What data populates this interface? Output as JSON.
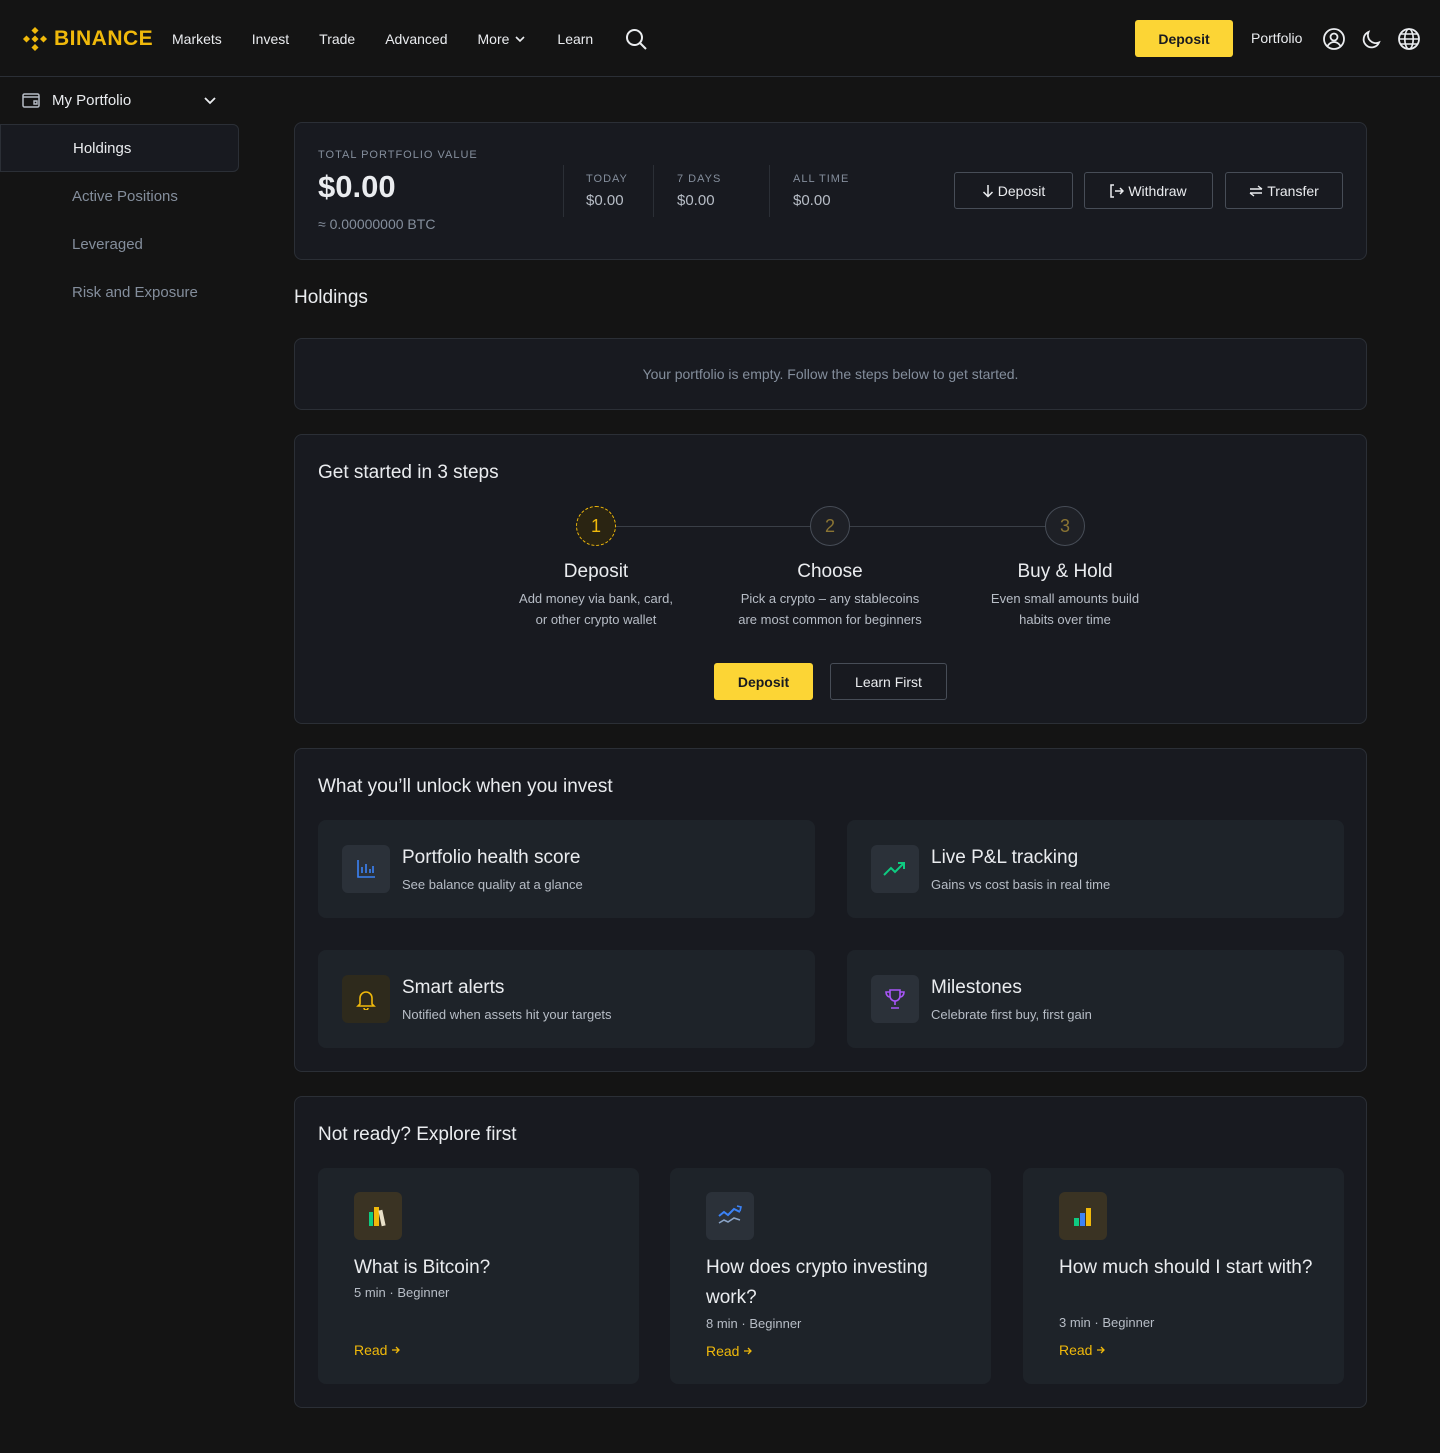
{
  "brand": {
    "name": "BINANCE",
    "color": "#f0b90b"
  },
  "nav": {
    "items": [
      {
        "label": "Markets"
      },
      {
        "label": "Invest"
      },
      {
        "label": "Trade"
      },
      {
        "label": "Advanced"
      },
      {
        "label": "More",
        "icon": "chevron-down-icon"
      },
      {
        "label": "Learn"
      }
    ],
    "deposit_label": "Deposit",
    "portfolio_label": "Portfolio",
    "icons": [
      "search-icon",
      "user-icon",
      "moon-icon",
      "globe-icon"
    ]
  },
  "sidebar": {
    "title": "My Portfolio",
    "items": [
      {
        "label": "Holdings",
        "active": true
      },
      {
        "label": "Active Positions"
      },
      {
        "label": "Leveraged"
      },
      {
        "label": "Risk and Exposure"
      }
    ]
  },
  "summary": {
    "total_label": "TOTAL PORTFOLIO VALUE",
    "total_value": "$0.00",
    "btc_value": "≈ 0.00000000 BTC",
    "stats": [
      {
        "label": "TODAY",
        "value": "$0.00"
      },
      {
        "label": "7 DAYS",
        "value": "$0.00"
      },
      {
        "label": "ALL TIME",
        "value": "$0.00"
      }
    ],
    "actions": {
      "deposit": "Deposit",
      "withdraw": "Withdraw",
      "transfer": "Transfer"
    }
  },
  "holdings": {
    "title": "Holdings",
    "empty_text": "Your portfolio is empty. Follow the steps below to get started."
  },
  "steps": {
    "title": "Get started in 3 steps",
    "items": [
      {
        "num": "1",
        "title": "Deposit",
        "line1": "Add money via bank, card,",
        "line2": "or other crypto wallet"
      },
      {
        "num": "2",
        "title": "Choose",
        "line1": "Pick a crypto – any stablecoins",
        "line2": "are most common for beginners"
      },
      {
        "num": "3",
        "title": "Buy & Hold",
        "line1": "Even small amounts build",
        "line2": "habits over time"
      }
    ],
    "deposit_label": "Deposit",
    "learn_label": "Learn First"
  },
  "unlock": {
    "title": "What you’ll unlock when you invest",
    "items": [
      {
        "title": "Portfolio health score",
        "desc": "See balance quality at a glance",
        "icon": "bar-chart-icon",
        "color": "#3b82f6"
      },
      {
        "title": "Live P&L tracking",
        "desc": "Gains vs cost basis in real time",
        "icon": "trend-up-icon",
        "color": "#0ecb81"
      },
      {
        "title": "Smart alerts",
        "desc": "Notified when assets hit your targets",
        "icon": "bell-icon",
        "color": "#f0b90b"
      },
      {
        "title": "Milestones",
        "desc": "Celebrate first buy, first gain",
        "icon": "trophy-icon",
        "color": "#a855f7"
      }
    ]
  },
  "explore": {
    "title": "Not ready? Explore first",
    "items": [
      {
        "title": "What is Bitcoin?",
        "meta": "5 min · Beginner",
        "read": "Read",
        "icon": "books-icon"
      },
      {
        "title": "How does crypto investing work?",
        "meta": "8 min · Beginner",
        "read": "Read",
        "icon": "chart-trend-icon"
      },
      {
        "title": "How much should I start with?",
        "meta": "3 min · Beginner",
        "read": "Read",
        "icon": "bar-chart-color-icon"
      }
    ]
  }
}
